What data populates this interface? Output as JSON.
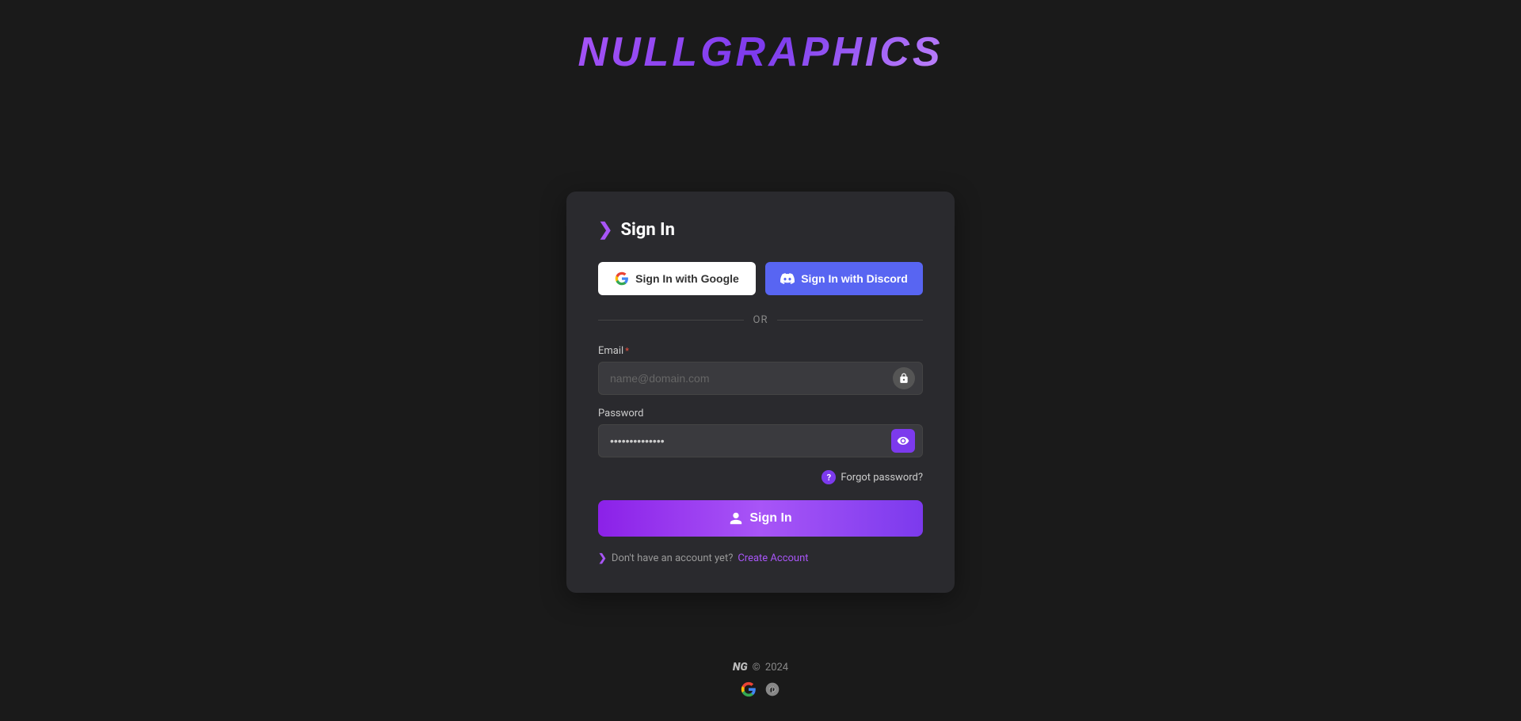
{
  "site": {
    "title": "NULLGRAPHICS"
  },
  "card": {
    "title": "Sign In",
    "chevron": "❯"
  },
  "buttons": {
    "google_label": "Sign In with Google",
    "discord_label": "Sign In with Discord",
    "signin_label": "Sign In"
  },
  "divider": {
    "text": "OR"
  },
  "form": {
    "email_label": "Email",
    "email_placeholder": "name@domain.com",
    "password_label": "Password",
    "password_placeholder": "••••••••••••••"
  },
  "forgot": {
    "label": "Forgot password?",
    "icon": "?"
  },
  "create_account": {
    "static_text": "Don't have an account yet?",
    "link_text": "Create Account"
  },
  "footer": {
    "ng": "NG",
    "copyright_symbol": "©",
    "year": "2024"
  },
  "colors": {
    "purple_primary": "#9333ea",
    "purple_dark": "#7c3aed",
    "discord_blue": "#5865f2",
    "bg_card": "#2a2a2e",
    "bg_input": "#3a3a3e"
  }
}
